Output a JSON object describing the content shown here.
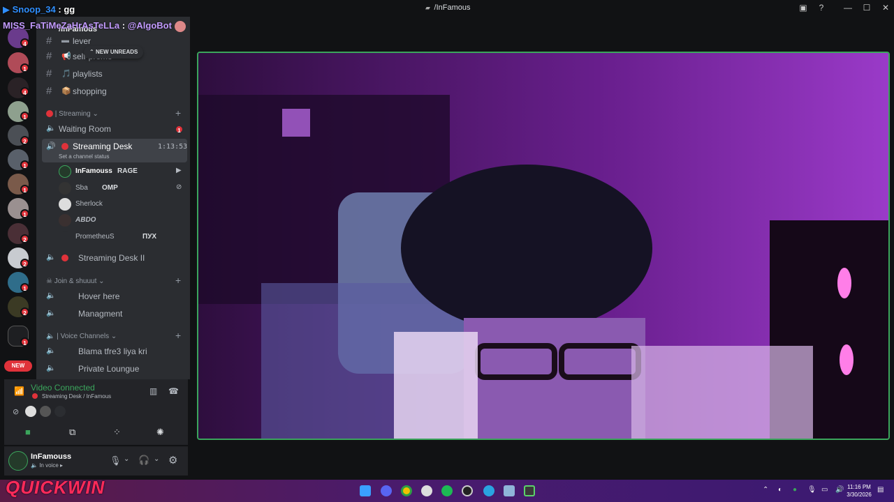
{
  "window": {
    "title": "/InFamous",
    "title_icon": "discord-icon"
  },
  "overlay_chat": [
    {
      "user": "Snoop_34",
      "sep": ":",
      "message": "gg",
      "color": "#2f8fff"
    },
    {
      "user": "MISS_FaTiMeZaHrAsTeLLa",
      "sep": ":",
      "message": "@AlgoBot",
      "color": "#c39bff"
    }
  ],
  "header_partial": "/InFamous",
  "new_unreads": "NEW UNREADS",
  "server_badges": [
    "2",
    "4",
    "1",
    "4",
    "1",
    "2",
    "1",
    "1",
    "1",
    "2",
    "2",
    "1",
    "2",
    "1"
  ],
  "server_new_label": "NEW",
  "channels_top": [
    {
      "emoji": "▬",
      "name": "lever"
    },
    {
      "emoji": "📢",
      "name": "self-promo"
    },
    {
      "emoji": "🎵",
      "name": "playlists"
    },
    {
      "emoji": "📦",
      "name": "shopping"
    }
  ],
  "categories": {
    "streaming": "| Streaming",
    "join": "Join & shuuut",
    "voice": "| Voice Channels"
  },
  "waiting_room": {
    "name": "Waiting Room",
    "badge": "1"
  },
  "streaming_desk": {
    "name": "Streaming Desk",
    "timer": "1:13:53",
    "status_hint": "Set a channel status"
  },
  "voice_members": [
    {
      "name": "InFamouss",
      "tag": "RAGE"
    },
    {
      "name": "Sba",
      "tag": "OMP"
    },
    {
      "name": "Sherlock",
      "tag": ""
    },
    {
      "name": "ABDO",
      "tag": ""
    },
    {
      "name": "PrometheuS",
      "tag": "ПУХ"
    }
  ],
  "streaming_desk_2": "Streaming Desk II",
  "join_channels": [
    "Hover here",
    "Managment"
  ],
  "voice_channels": [
    "Blama tfre3 liya kri",
    "Private Loungue"
  ],
  "voice_panel": {
    "status": "Video Connected",
    "location": "Streaming Desk / InFamous"
  },
  "user_panel": {
    "name": "InFamouss",
    "status": "In voice"
  },
  "watermark": "QUICKWIN",
  "clock": {
    "time": "11:16 PM",
    "date": "3/30/2026"
  },
  "colors": {
    "accent_green": "#3ba55c",
    "badge_red": "#e0323a",
    "sidebar": "#2b2d31",
    "rail": "#111214"
  }
}
